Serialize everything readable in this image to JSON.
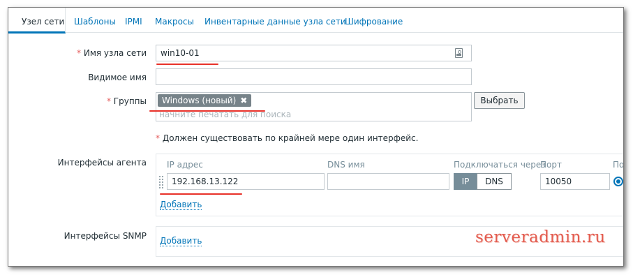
{
  "tabs": [
    {
      "label": "Узел сети",
      "active": true
    },
    {
      "label": "Шаблоны"
    },
    {
      "label": "IPMI"
    },
    {
      "label": "Макросы"
    },
    {
      "label": "Инвентарные данные узла сети"
    },
    {
      "label": "Шифрование"
    }
  ],
  "form": {
    "required_mark": "*",
    "hostname_label": "Имя узла сети",
    "hostname_value": "win10-01",
    "visible_name_label": "Видимое имя",
    "visible_name_value": "",
    "groups_label": "Группы",
    "group_chip": "Windows (новый)",
    "group_chip_remove": "✖",
    "groups_placeholder": "начните печатать для поиска",
    "select_button": "Выбрать",
    "interface_note": "Должен существовать по крайней мере один интерфейс."
  },
  "agent_interfaces": {
    "label": "Интерфейсы агента",
    "headers": {
      "ip": "IP адрес",
      "dns": "DNS имя",
      "connect_via": "Подключаться через",
      "port": "Порт",
      "default_truncated": "По"
    },
    "row": {
      "ip": "192.168.13.122",
      "dns": "",
      "connect_ip": "IP",
      "connect_dns": "DNS",
      "connect_selected": "IP",
      "port": "10050",
      "default_selected": true
    },
    "add_link": "Добавить"
  },
  "snmp_interfaces": {
    "label": "Интерфейсы SNMP",
    "add_link": "Добавить"
  },
  "watermark": "serveradmin.ru",
  "colors": {
    "link": "#0275b8",
    "required": "#e45959",
    "annotation_line": "#e8312a",
    "chip_bg": "#778389",
    "segment_active": "#768d99"
  }
}
